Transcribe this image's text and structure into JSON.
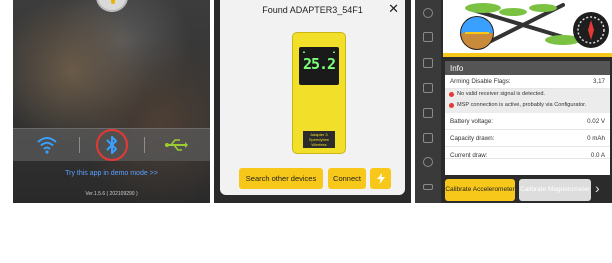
{
  "panel1": {
    "icons": [
      "lamp-icon",
      "wifi-icon",
      "bluetooth-icon",
      "usb-icon"
    ],
    "demo_link": "Try this app in demo mode >>",
    "version": "Ver.1.5.6 ( 202109290 )",
    "colors": {
      "accent_red": "#e53935",
      "link_blue": "#5aa0ff",
      "usb_green": "#9acd32"
    }
  },
  "panel2": {
    "title": "Found ADAPTER3_54F1",
    "close_icon": "close-icon",
    "device": {
      "reading": "25.2",
      "label_line1": "Adapter 3",
      "label_line2": "Speedybee Wireless"
    },
    "buttons": {
      "search": "Search other devices",
      "connect": "Connect",
      "flash_icon": "lightning-icon"
    },
    "colors": {
      "button_yellow": "#f7c81a",
      "device_yellow": "#f2df2a"
    }
  },
  "panel3": {
    "info_title": "Info",
    "rows": [
      {
        "label": "Arming Disable Flags:",
        "value": "3,17"
      }
    ],
    "warnings": [
      "No valid receiver signal is detected.",
      "MSP connection is active, probably via Configurator."
    ],
    "rows2": [
      {
        "label": "Battery voltage:",
        "value": "0.02 V"
      },
      {
        "label": "Capacity drawn:",
        "value": "0 mAh"
      },
      {
        "label": "Current draw:",
        "value": "0.0 A"
      }
    ],
    "buttons": {
      "calibrate_acc": "Calibrate Accelerometer",
      "calibrate_mag": "Calibrate Magnetometer"
    },
    "chevron_icon": "chevron-right-icon"
  }
}
